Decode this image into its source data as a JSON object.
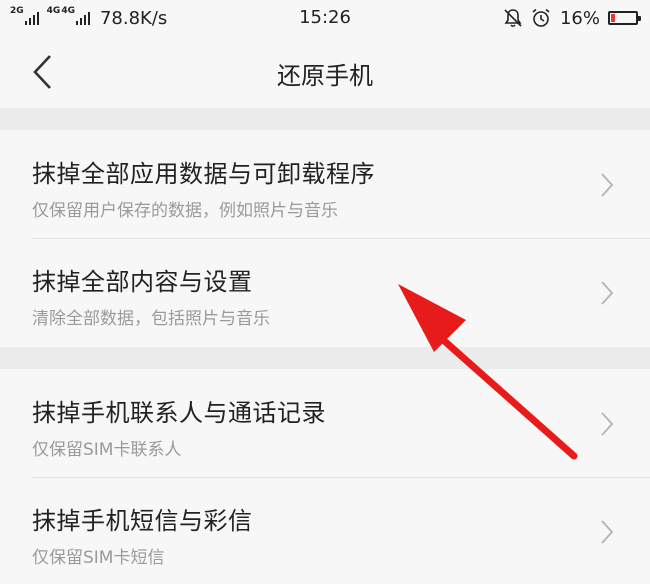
{
  "status_bar": {
    "network_type_1": "2G",
    "network_type_2": "4G",
    "network_type_3": "4G",
    "net_speed": "78.8K/s",
    "time": "15:26",
    "battery_percent": "16%",
    "battery_level": 0.16,
    "icons": [
      "signal-icon",
      "signal-icon",
      "notification-muted-icon",
      "alarm-icon",
      "battery-icon"
    ]
  },
  "header": {
    "title": "还原手机",
    "back_icon": "chevron-left-icon"
  },
  "groups": [
    {
      "items": [
        {
          "title": "抹掉全部应用数据与可卸载程序",
          "desc": "仅保留用户保存的数据，例如照片与音乐"
        },
        {
          "title": "抹掉全部内容与设置",
          "desc": "清除全部数据，包括照片与音乐"
        }
      ]
    },
    {
      "items": [
        {
          "title": "抹掉手机联系人与通话记录",
          "desc": "仅保留SIM卡联系人"
        },
        {
          "title": "抹掉手机短信与彩信",
          "desc": "仅保留SIM卡短信"
        }
      ]
    }
  ],
  "colors": {
    "annotation_arrow": "#e81b1b",
    "battery_low": "#e53935",
    "background": "#f7f7f7",
    "divider": "#ececec"
  }
}
